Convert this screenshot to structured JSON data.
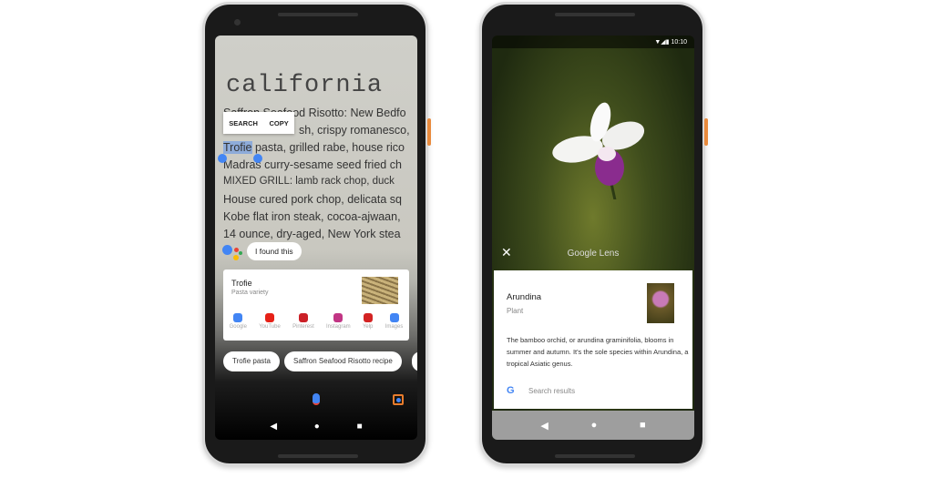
{
  "phone1": {
    "document_title": "california",
    "menu_lines": [
      "Saffron Seafood Risotto: New Bedfo",
      "sh, crispy romanesco,",
      "pasta, grilled rabe, house rico",
      "Madras curry-sesame seed fried ch",
      "MIXED GRILL: lamb rack chop, duck",
      "House cured pork chop, delicata sq",
      "Kobe flat iron steak, cocoa-ajwaan,",
      "14 ounce, dry-aged, New York stea"
    ],
    "selected_word": "Trofie",
    "context_menu": {
      "search": "SEARCH",
      "copy": "COPY"
    },
    "assistant_bubble": "I found this",
    "result_card": {
      "title": "Trofie",
      "subtitle": "Pasta variety",
      "apps": [
        {
          "label": "Google",
          "icon": "google-icon",
          "color": "#4285f4"
        },
        {
          "label": "YouTube",
          "icon": "youtube-icon",
          "color": "#e62117"
        },
        {
          "label": "Pinterest",
          "icon": "pinterest-icon",
          "color": "#cb2027"
        },
        {
          "label": "Instagram",
          "icon": "instagram-icon",
          "color": "#c13584"
        },
        {
          "label": "Yelp",
          "icon": "yelp-icon",
          "color": "#d32323"
        },
        {
          "label": "Images",
          "icon": "images-icon",
          "color": "#4285f4"
        }
      ]
    },
    "chips": [
      "Trofie pasta",
      "Saffron Seafood Risotto recipe"
    ]
  },
  "phone2": {
    "status_time": "10:10",
    "app_title": "Google Lens",
    "result": {
      "title": "Arundina",
      "subtitle": "Plant",
      "description": "The bamboo orchid, or arundina graminifolia, blooms in summer and autumn. It's the sole species within Arundina, a tropical Asiatic genus.",
      "search_label": "Search results"
    }
  },
  "colors": {
    "accent": "#4285f4",
    "highlight": "#4285f4"
  }
}
